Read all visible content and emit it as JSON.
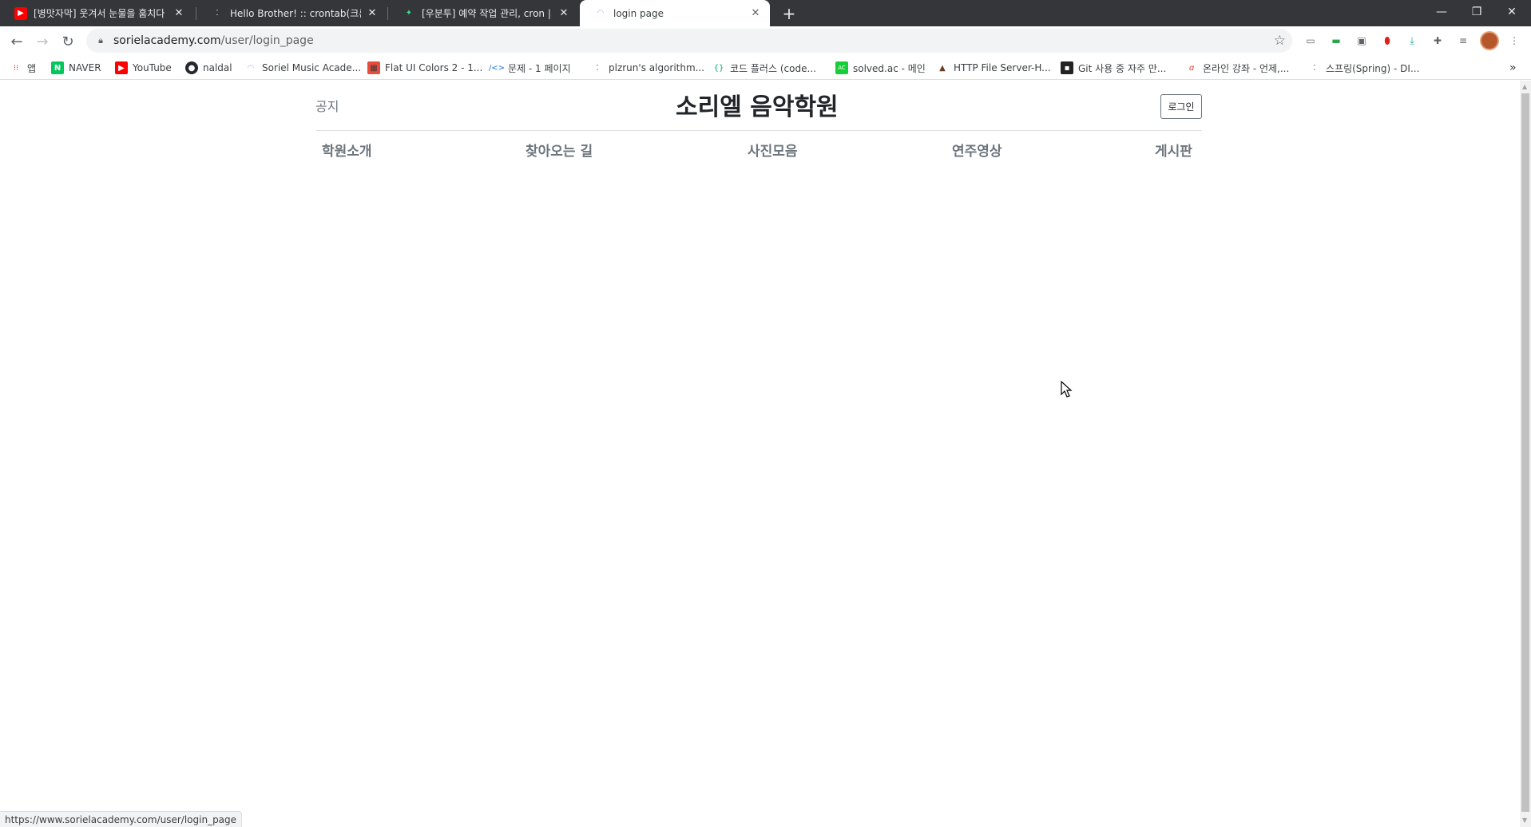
{
  "tabs": [
    {
      "title": "[병맛자막] 웃겨서 눈물을 훔치다",
      "favicon": "youtube-icon",
      "color": "#ff0000"
    },
    {
      "title": "Hello Brother! :: crontab(크론탭",
      "favicon": "tistory-icon",
      "color": "#e8eaed"
    },
    {
      "title": "[우분투] 예약 작업 관리, cron | ",
      "favicon": "site-icon",
      "color": "#3ddc84"
    },
    {
      "title": "login page",
      "favicon": "piano-icon",
      "color": "#c9a3e6"
    }
  ],
  "toolbar": {
    "url_host": "sorielacademy.com",
    "url_path": "/user/login_page"
  },
  "bookmarks": [
    {
      "label": "앱",
      "icon": "apps-grid-icon"
    },
    {
      "label": "NAVER",
      "icon": "naver-icon"
    },
    {
      "label": "YouTube",
      "icon": "youtube-icon"
    },
    {
      "label": "naldal",
      "icon": "github-icon"
    },
    {
      "label": "Soriel Music Acade...",
      "icon": "piano-icon"
    },
    {
      "label": "Flat UI Colors 2 - 1...",
      "icon": "flatui-icon"
    },
    {
      "label": "문제 - 1 페이지",
      "icon": "code-icon"
    },
    {
      "label": "plzrun's algorithm...",
      "icon": "tistory-icon"
    },
    {
      "label": "코드 플러스 (code...",
      "icon": "braces-icon"
    },
    {
      "label": "solved.ac - 메인",
      "icon": "solvedac-icon"
    },
    {
      "label": "HTTP File Server-H...",
      "icon": "server-icon"
    },
    {
      "label": "Git 사용 중 자주 만...",
      "icon": "git-icon"
    },
    {
      "label": "온라인 강좌 - 언제,...",
      "icon": "inflearn-icon"
    },
    {
      "label": "스프링(Spring) - DI...",
      "icon": "tistory-icon"
    }
  ],
  "site": {
    "notice": "공지",
    "brand": "소리엘 음악학원",
    "login_label": "로그인",
    "nav": [
      "학원소개",
      "찾아오는 길",
      "사진모음",
      "연주영상",
      "게시판"
    ]
  },
  "status_url": "https://www.sorielacademy.com/user/login_page",
  "colors": {
    "tabstrip": "#35363a",
    "brand_text": "#212529",
    "nav_text": "#6c757d"
  }
}
